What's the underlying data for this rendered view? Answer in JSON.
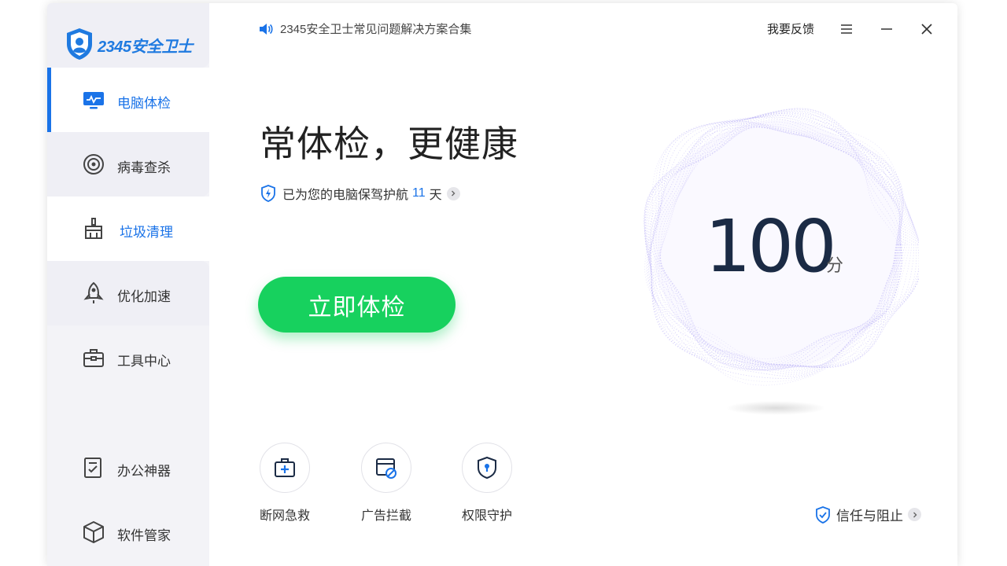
{
  "app": {
    "logo_text": "2345安全卫士"
  },
  "sidebar": {
    "items": [
      {
        "label": "电脑体检",
        "icon": "monitor-icon"
      },
      {
        "label": "病毒查杀",
        "icon": "target-icon"
      },
      {
        "label": "垃圾清理",
        "icon": "broom-icon"
      },
      {
        "label": "优化加速",
        "icon": "rocket-icon"
      },
      {
        "label": "工具中心",
        "icon": "toolbox-icon"
      },
      {
        "label": "办公神器",
        "icon": "clipboard-icon"
      },
      {
        "label": "软件管家",
        "icon": "cube-icon"
      }
    ]
  },
  "header": {
    "notice": "2345安全卫士常见问题解决方案合集",
    "feedback": "我要反馈"
  },
  "main": {
    "headline": "常体检，更健康",
    "guard_prefix": "已为您的电脑保驾护航",
    "guard_days": "11",
    "guard_suffix": "天",
    "check_button": "立即体检",
    "score": "100",
    "score_unit": "分",
    "tools": [
      {
        "label": "断网急救",
        "icon": "first-aid-kit-icon"
      },
      {
        "label": "广告拦截",
        "icon": "ad-block-icon"
      },
      {
        "label": "权限守护",
        "icon": "shield-lock-icon"
      }
    ],
    "trust": "信任与阻止"
  },
  "colors": {
    "accent": "#1a73e8",
    "primary_button": "#17d15e",
    "sphere": "#8a7cf0"
  }
}
